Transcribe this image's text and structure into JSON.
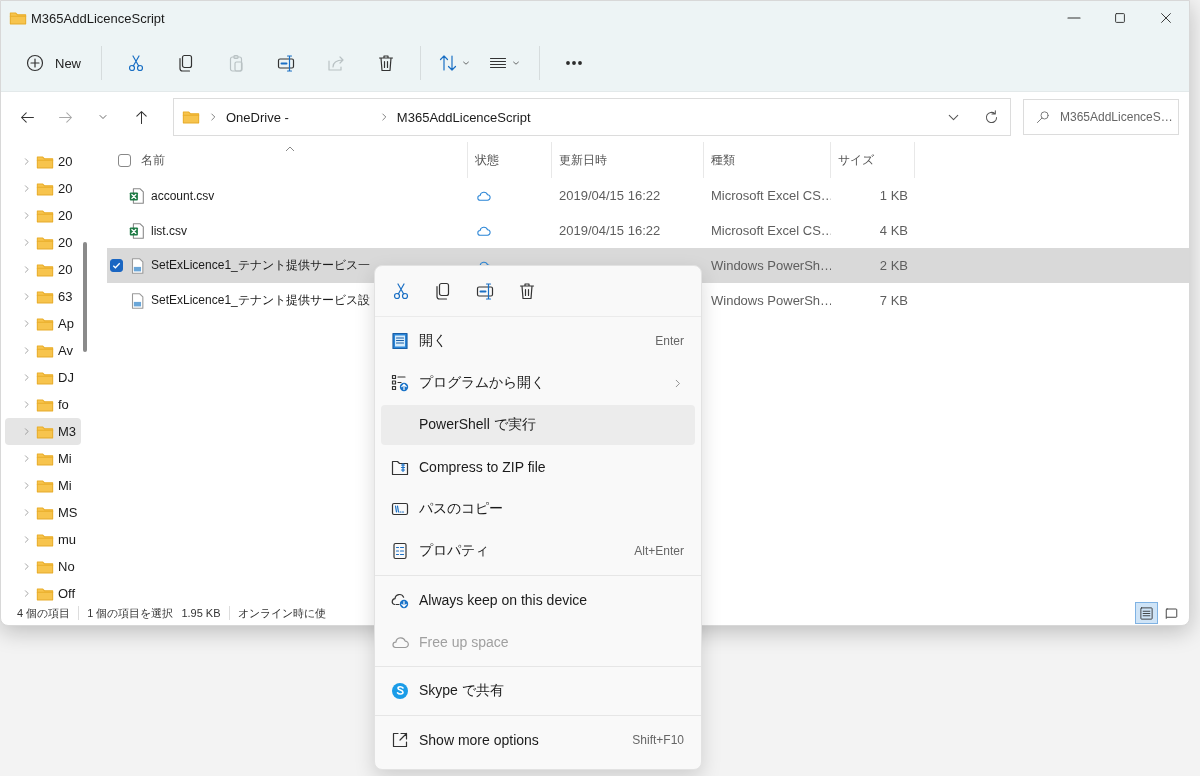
{
  "window": {
    "title": "M365AddLicenceScript"
  },
  "toolbar": {
    "items": [
      {
        "kind": "new",
        "label": "New",
        "disabled": false
      },
      {
        "kind": "separator"
      },
      {
        "kind": "cut",
        "disabled": false
      },
      {
        "kind": "copy",
        "disabled": false
      },
      {
        "kind": "paste",
        "disabled": true
      },
      {
        "kind": "rename",
        "disabled": false
      },
      {
        "kind": "share",
        "disabled": true
      },
      {
        "kind": "delete",
        "disabled": false
      },
      {
        "kind": "separator"
      },
      {
        "kind": "sort",
        "disabled": false
      },
      {
        "kind": "view",
        "disabled": false
      },
      {
        "kind": "separator"
      },
      {
        "kind": "more",
        "disabled": false
      }
    ]
  },
  "navigation": {
    "back_disabled": false,
    "forward_disabled": true
  },
  "address": {
    "segments": [
      "OneDrive -",
      "M365AddLicenceScript"
    ]
  },
  "search": {
    "placeholder": "M365AddLicenceS…"
  },
  "sidebar": {
    "items": [
      {
        "label": "20",
        "selected": false
      },
      {
        "label": "20",
        "selected": false
      },
      {
        "label": "20",
        "selected": false
      },
      {
        "label": "20",
        "selected": false
      },
      {
        "label": "20",
        "selected": false
      },
      {
        "label": "63",
        "selected": false
      },
      {
        "label": "Ap",
        "selected": false
      },
      {
        "label": "Av",
        "selected": false
      },
      {
        "label": "DJ",
        "selected": false
      },
      {
        "label": "fo",
        "selected": false
      },
      {
        "label": "M3",
        "selected": true
      },
      {
        "label": "Mi",
        "selected": false
      },
      {
        "label": "Mi",
        "selected": false
      },
      {
        "label": "MS",
        "selected": false
      },
      {
        "label": "mu",
        "selected": false
      },
      {
        "label": "No",
        "selected": false
      },
      {
        "label": "Off",
        "selected": false
      }
    ]
  },
  "table": {
    "select_all": false,
    "columns": [
      "名前",
      "状態",
      "更新日時",
      "種類",
      "サイズ"
    ],
    "rows": [
      {
        "name": "account.csv",
        "kind": "excel",
        "cloud": true,
        "modified": "2019/04/15 16:22",
        "type": "Microsoft Excel CS…",
        "size": "1 KB",
        "selected": false,
        "checked": false
      },
      {
        "name": "list.csv",
        "kind": "excel",
        "cloud": true,
        "modified": "2019/04/15 16:22",
        "type": "Microsoft Excel CS…",
        "size": "4 KB",
        "selected": false,
        "checked": false
      },
      {
        "name": "SetExLicence1_テナント提供サービス一",
        "kind": "script",
        "cloud": true,
        "type": "Windows PowerSh…",
        "size": "2 KB",
        "selected": true,
        "checked": true
      },
      {
        "name": "SetExLicence1_テナント提供サービス設",
        "kind": "script",
        "type": "Windows PowerSh…",
        "size": "7 KB",
        "selected": false,
        "checked": false
      }
    ]
  },
  "status_bar": {
    "items": [
      "4 個の項目",
      "1 個の項目を選択",
      "1.95 KB",
      "オンライン時に使"
    ],
    "views": [
      {
        "kind": "details",
        "selected": true
      },
      {
        "kind": "tiles",
        "selected": false
      }
    ]
  },
  "context_menu": {
    "quick_actions": [
      {
        "kind": "cut"
      },
      {
        "kind": "copy"
      },
      {
        "kind": "rename"
      },
      {
        "kind": "delete"
      }
    ],
    "sections": [
      [
        {
          "kind": "open",
          "label": "開く",
          "shortcut": "Enter",
          "highlighted": false,
          "disabled": false,
          "submenu": false
        },
        {
          "kind": "open_with",
          "label": "プログラムから開く",
          "highlighted": false,
          "disabled": false,
          "submenu": true
        },
        {
          "kind": "none",
          "label": "PowerShell で実行",
          "highlighted": true,
          "disabled": false,
          "submenu": false
        },
        {
          "kind": "compress",
          "label": "Compress to ZIP file",
          "highlighted": false,
          "disabled": false,
          "submenu": false
        },
        {
          "kind": "copy_path",
          "label": "パスのコピー",
          "highlighted": false,
          "disabled": false,
          "submenu": false
        },
        {
          "kind": "properties",
          "label": "プロパティ",
          "shortcut": "Alt+Enter",
          "highlighted": false,
          "disabled": false,
          "submenu": false
        }
      ],
      [
        {
          "kind": "keep",
          "label": "Always keep on this device",
          "highlighted": false,
          "disabled": false,
          "submenu": false
        },
        {
          "kind": "free",
          "label": "Free up space",
          "highlighted": false,
          "disabled": true,
          "submenu": false
        }
      ],
      [
        {
          "kind": "skype",
          "label": "Skype で共有",
          "highlighted": false,
          "disabled": false,
          "submenu": false
        }
      ],
      [
        {
          "kind": "more_options",
          "label": "Show more options",
          "shortcut": "Shift+F10",
          "highlighted": false,
          "disabled": false,
          "submenu": false
        }
      ]
    ]
  }
}
